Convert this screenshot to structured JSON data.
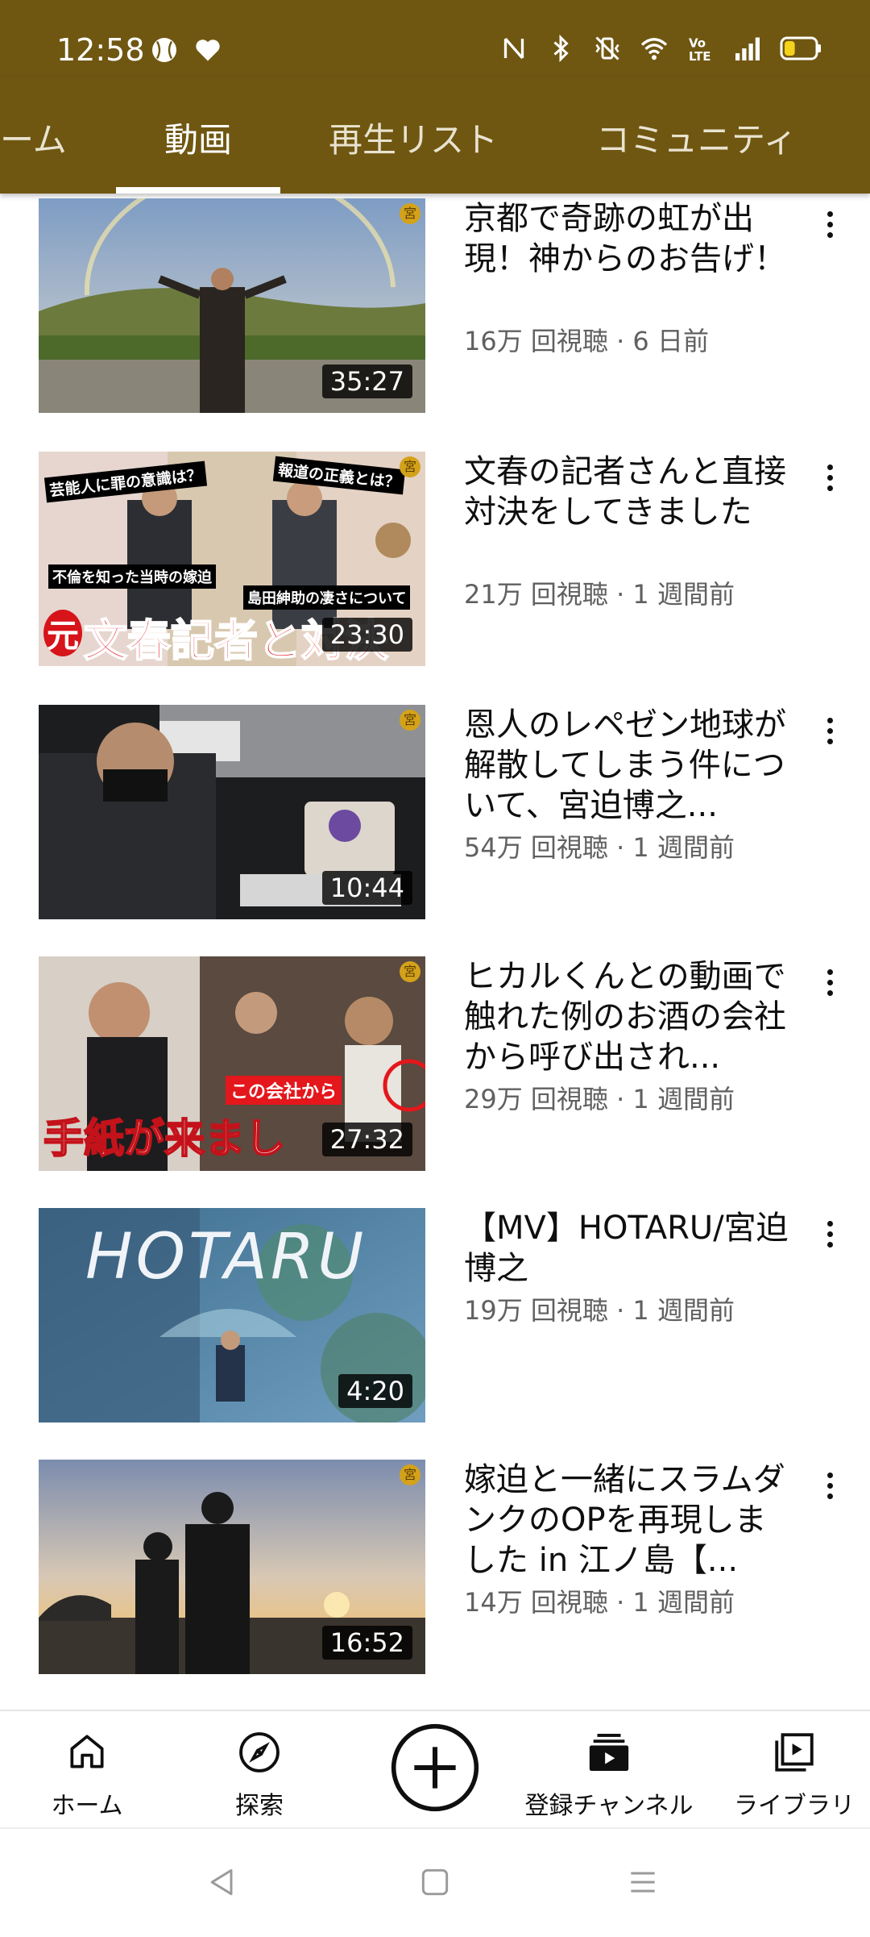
{
  "status_bar": {
    "time": "12:58",
    "left_icons": [
      "baseball-icon",
      "heart-icon"
    ],
    "right_icons": [
      "nfc-icon",
      "bluetooth-icon",
      "vibrate-icon",
      "wifi-icon",
      "volte-icon",
      "signal-icon",
      "battery-icon"
    ],
    "battery_level": 0.35
  },
  "tabs": {
    "items": [
      "ーム",
      "動画",
      "再生リスト",
      "コミュニティ"
    ],
    "active": "動画"
  },
  "videos": [
    {
      "title": "京都で奇跡の虹が出現！神からのお告げ！",
      "meta": "16万 回視聴 · 6 日前",
      "duration": "35:27"
    },
    {
      "title": "文春の記者さんと直接対決をしてきました",
      "meta": "21万 回視聴 · 1 週間前",
      "duration": "23:30",
      "thumb_text": [
        "芸能人に罪の意識は？",
        "報道の正義とは？",
        "不倫を知った当時の嫁迫",
        "島田紳助の凄さについて",
        "元",
        "文春記者と対決"
      ]
    },
    {
      "title": "恩人のレペゼン地球が解散してしまう件について、宮迫博之...",
      "meta": "54万 回視聴 · 1 週間前",
      "duration": "10:44"
    },
    {
      "title": "ヒカルくんとの動画で触れた例のお酒の会社から呼び出され...",
      "meta": "29万 回視聴 · 1 週間前",
      "duration": "27:32",
      "thumb_text": [
        "この会社から",
        "手紙が来まし"
      ]
    },
    {
      "title": "【MV】HOTARU/宮迫博之",
      "meta": "19万 回視聴 · 1 週間前",
      "duration": "4:20",
      "thumb_text": [
        "HOTARU"
      ]
    },
    {
      "title": "嫁迫と一緒にスラムダンクのOPを再現しました in 江ノ島【...",
      "meta": "14万 回視聴 · 1 週間前",
      "duration": "16:52"
    }
  ],
  "badge_char": "宮",
  "bottom_nav": {
    "home": "ホーム",
    "explore": "探索",
    "subscriptions": "登録チャンネル",
    "library": "ライブラリ"
  },
  "colors": {
    "header_bg": "#6f5712",
    "text_primary": "#0f0f0f",
    "text_secondary": "#606060"
  }
}
